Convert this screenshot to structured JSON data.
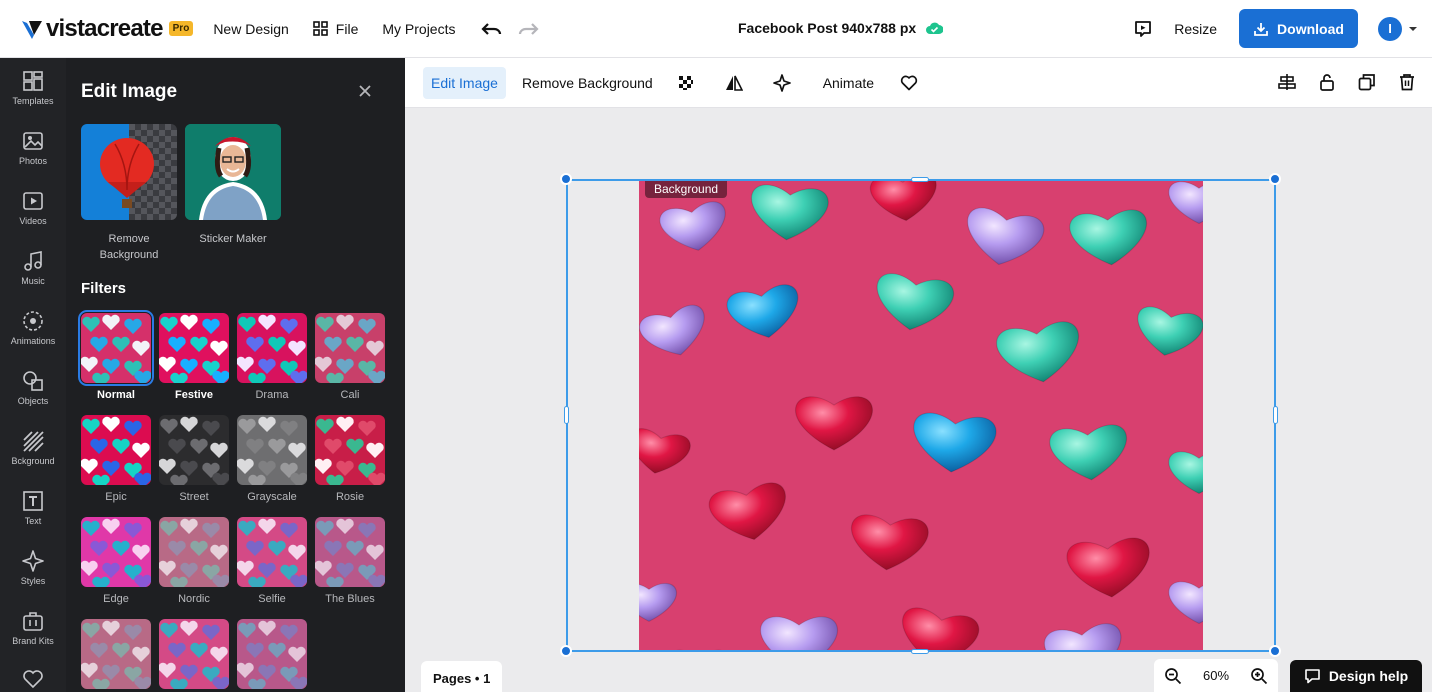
{
  "app": {
    "logo_text": "vistacreate",
    "pro_badge": "Pro"
  },
  "topbar": {
    "new_design": "New Design",
    "file": "File",
    "my_projects": "My Projects",
    "doc_title": "Facebook Post 940x788 px",
    "resize": "Resize",
    "download": "Download",
    "avatar_initial": "I"
  },
  "rail": {
    "items": [
      {
        "label": "Templates",
        "icon": "templates-icon"
      },
      {
        "label": "Photos",
        "icon": "photos-icon"
      },
      {
        "label": "Videos",
        "icon": "videos-icon"
      },
      {
        "label": "Music",
        "icon": "music-icon"
      },
      {
        "label": "Animations",
        "icon": "animations-icon"
      },
      {
        "label": "Objects",
        "icon": "objects-icon"
      },
      {
        "label": "Bckground",
        "icon": "background-icon"
      },
      {
        "label": "Text",
        "icon": "text-icon"
      },
      {
        "label": "Styles",
        "icon": "styles-icon"
      },
      {
        "label": "Brand Kits",
        "icon": "brand-kits-icon"
      }
    ]
  },
  "panel": {
    "title": "Edit Image",
    "tools": [
      {
        "label": "Remove Background"
      },
      {
        "label": "Sticker Maker"
      }
    ],
    "filters_title": "Filters",
    "filters": [
      {
        "label": "Normal"
      },
      {
        "label": "Festive"
      },
      {
        "label": "Drama"
      },
      {
        "label": "Cali"
      },
      {
        "label": "Epic"
      },
      {
        "label": "Street"
      },
      {
        "label": "Grayscale"
      },
      {
        "label": "Rosie"
      },
      {
        "label": "Edge"
      },
      {
        "label": "Nordic"
      },
      {
        "label": "Selfie"
      },
      {
        "label": "The Blues"
      }
    ],
    "selected_filter": "Normal"
  },
  "subbar": {
    "edit_image": "Edit Image",
    "remove_background": "Remove Background",
    "animate": "Animate"
  },
  "canvas": {
    "layer_tag": "Background",
    "pages_label": "Pages • 1",
    "zoom": "60%"
  },
  "help": {
    "label": "Design help"
  },
  "colors": {
    "accent": "#1a6fd4",
    "selection": "#3d9be9",
    "rail_bg": "#222326",
    "panel_bg": "#1e1f22",
    "pro_badge": "#f5b72a"
  }
}
